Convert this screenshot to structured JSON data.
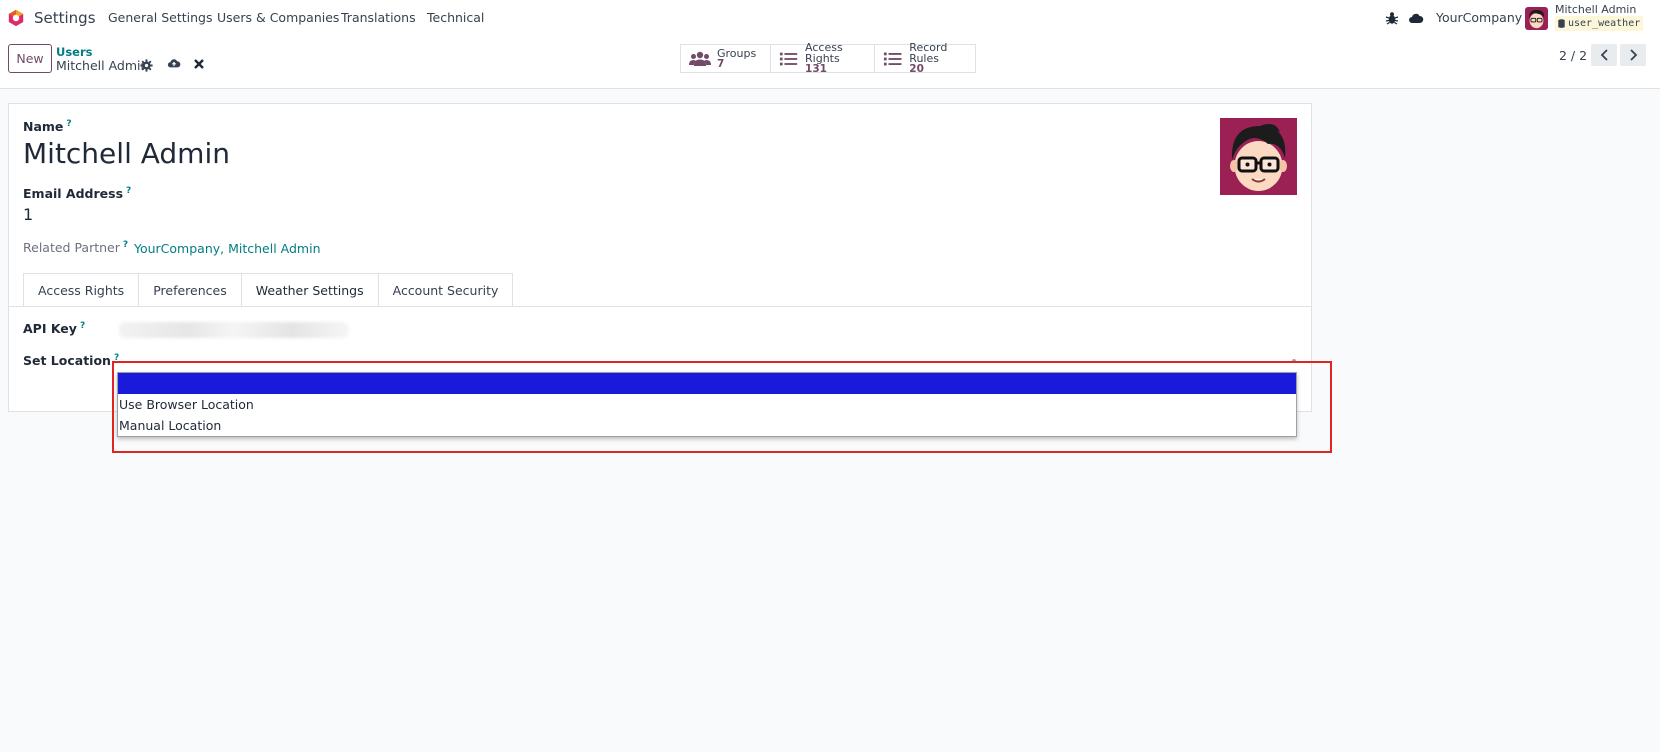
{
  "navbar": {
    "app_name": "Settings",
    "menu": [
      "General Settings",
      "Users & Companies",
      "Translations",
      "Technical"
    ],
    "company": "YourCompany",
    "user_name": "Mitchell Admin",
    "database": "user_weather",
    "icons": [
      "odoo-logo-icon",
      "bug-icon",
      "cloud-icon"
    ]
  },
  "control_panel": {
    "new_label": "New",
    "breadcrumb": "Users",
    "record_name": "Mitchell Admin",
    "smart_buttons": [
      {
        "label": "Groups",
        "value": "7",
        "icon": "users-icon"
      },
      {
        "label": "Access Rights",
        "value": "131",
        "icon": "list-icon"
      },
      {
        "label": "Record Rules",
        "value": "20",
        "icon": "list-icon"
      }
    ],
    "pager": "2 / 2"
  },
  "form": {
    "name_label": "Name",
    "name_value": "Mitchell Admin",
    "email_label": "Email Address",
    "email_value": "1",
    "partner_label": "Related Partner",
    "partner_value": "YourCompany, Mitchell Admin",
    "help_mark": "?",
    "tabs": [
      "Access Rights",
      "Preferences",
      "Weather Settings",
      "Account Security"
    ],
    "active_tab": "Weather Settings",
    "api_key_label": "API Key",
    "location_label": "Set Location"
  },
  "dropdown": {
    "options": [
      "",
      "Use Browser Location",
      "Manual Location"
    ],
    "selected_index": 0
  },
  "colors": {
    "brand": "#714B67",
    "link": "#017e84",
    "selection": "#1a1adb",
    "highlight": "#e02424"
  }
}
